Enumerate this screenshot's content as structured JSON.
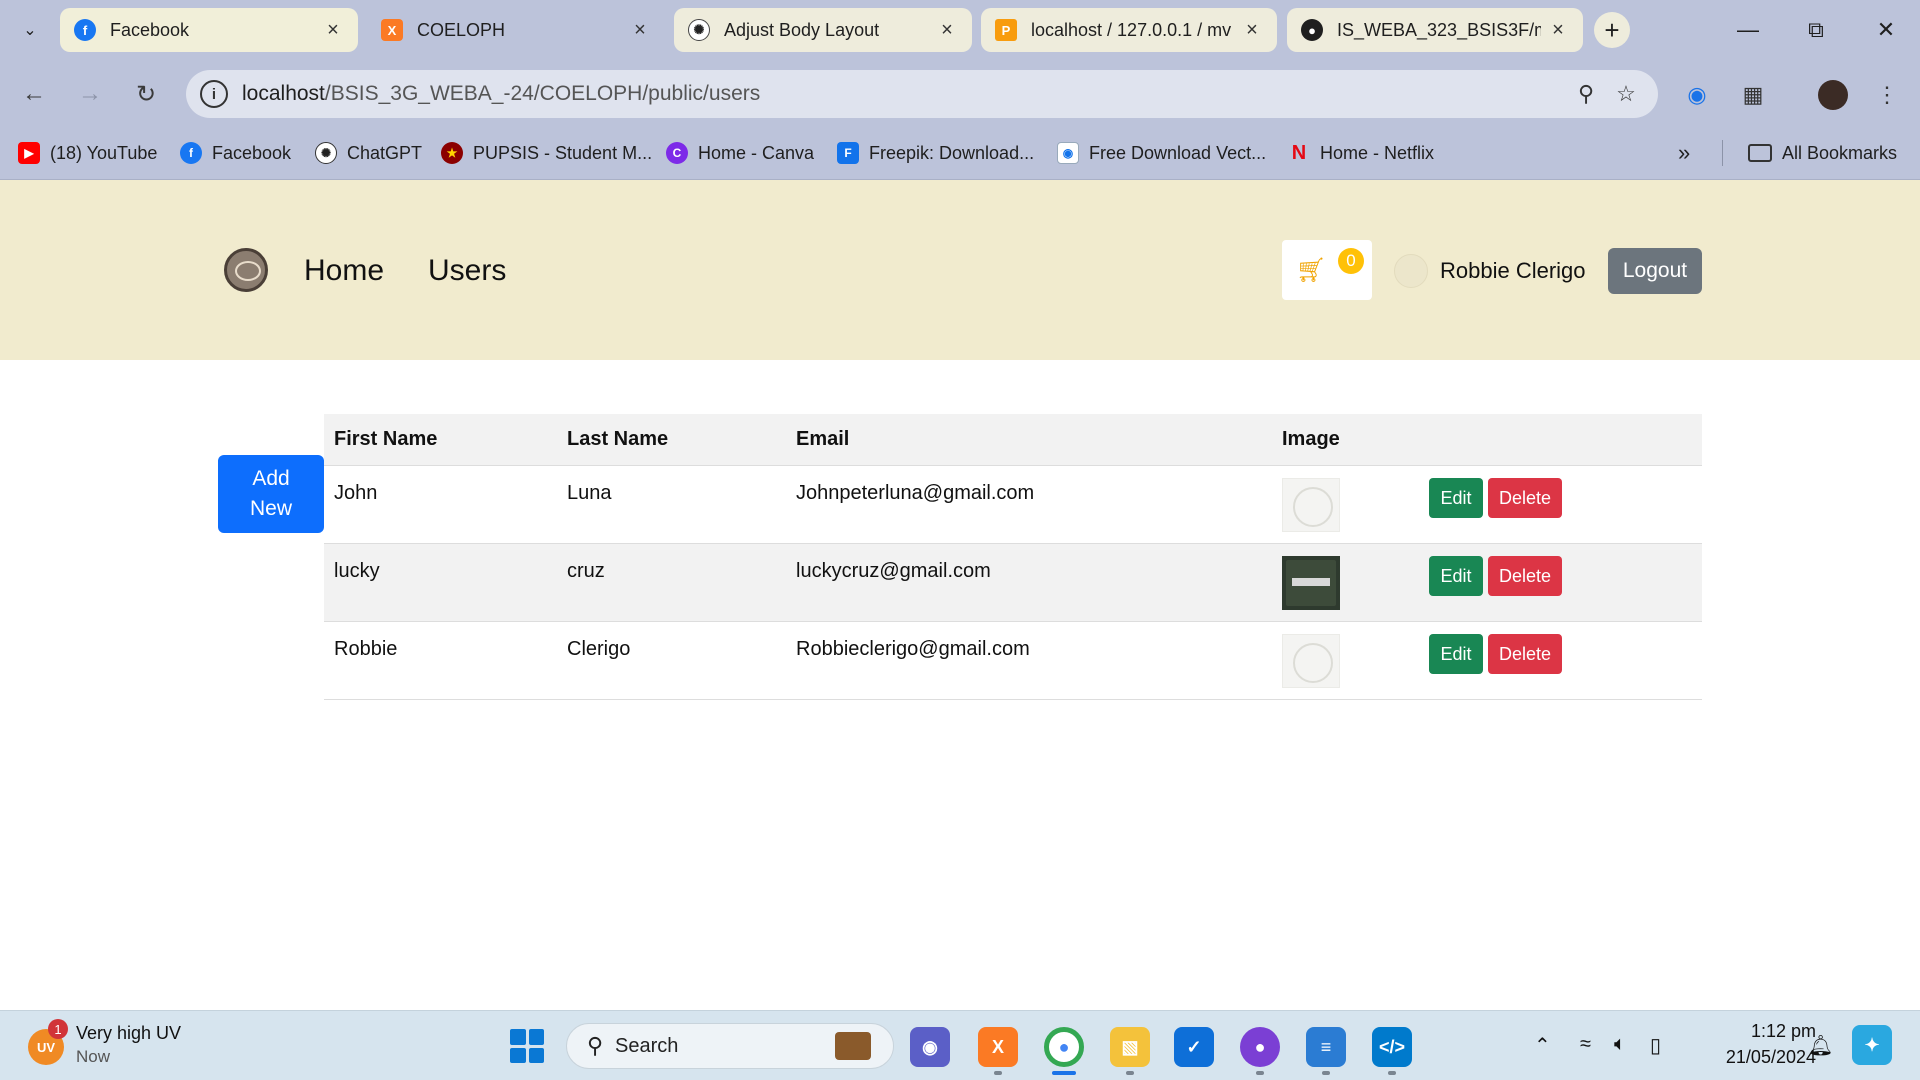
{
  "browser": {
    "tabs": [
      {
        "title": "Facebook",
        "favicon": "facebook-icon",
        "active": true
      },
      {
        "title": "COELOPH",
        "favicon": "xampp-icon",
        "active": false
      },
      {
        "title": "Adjust Body Layout",
        "favicon": "chatgpt-icon",
        "active": false
      },
      {
        "title": "localhost / 127.0.0.1 / mv",
        "favicon": "phpmyadmin-icon",
        "active": false
      },
      {
        "title": "IS_WEBA_323_BSIS3F/mv",
        "favicon": "github-icon",
        "active": false
      }
    ],
    "url_host": "localhost",
    "url_path": "/BSIS_3G_WEBA_-24/COELOPH/public/users",
    "bookmarks": [
      {
        "label": "(18) YouTube",
        "icon": "youtube-icon",
        "color": "#ff0000"
      },
      {
        "label": "Facebook",
        "icon": "facebook-icon",
        "color": "#1877f2"
      },
      {
        "label": "ChatGPT",
        "icon": "chatgpt-icon",
        "color": "#222222"
      },
      {
        "label": "PUPSIS - Student M...",
        "icon": "pup-icon",
        "color": "#8b0000"
      },
      {
        "label": "Home - Canva",
        "icon": "canva-icon",
        "color": "#7d2ae8"
      },
      {
        "label": "Freepik: Download...",
        "icon": "freepik-icon",
        "color": "#1273eb"
      },
      {
        "label": "Free Download Vect...",
        "icon": "vecteezy-icon",
        "color": "#ffffff"
      },
      {
        "label": "Home - Netflix",
        "icon": "netflix-icon",
        "color": "#e50914"
      }
    ],
    "all_bookmarks": "All Bookmarks"
  },
  "site": {
    "nav": {
      "home": "Home",
      "users": "Users"
    },
    "cart_count": "0",
    "user_name": "Robbie Clerigo",
    "logout_label": "Logout",
    "add_new_label": "Add New",
    "table": {
      "headers": [
        "First Name",
        "Last Name",
        "Email",
        "Image"
      ],
      "rows": [
        {
          "first": "John",
          "last": "Luna",
          "email": "Johnpeterluna@gmail.com",
          "image": "light"
        },
        {
          "first": "lucky",
          "last": "cruz",
          "email": "luckycruz@gmail.com",
          "image": "dark"
        },
        {
          "first": "Robbie",
          "last": "Clerigo",
          "email": "Robbieclerigo@gmail.com",
          "image": "light"
        }
      ],
      "edit_label": "Edit",
      "delete_label": "Delete"
    },
    "colors": {
      "navbar_bg": "#f1ebce",
      "primary": "#0d6efd",
      "success": "#198754",
      "danger": "#dc3545",
      "secondary": "#6c757d",
      "warning": "#ffc107"
    }
  },
  "taskbar": {
    "weather_title": "Very high UV",
    "weather_sub": "Now",
    "weather_badge": "1",
    "weather_icon_text": "UV",
    "search_label": "Search",
    "time": "1:12 pm",
    "date": "21/05/2024"
  }
}
